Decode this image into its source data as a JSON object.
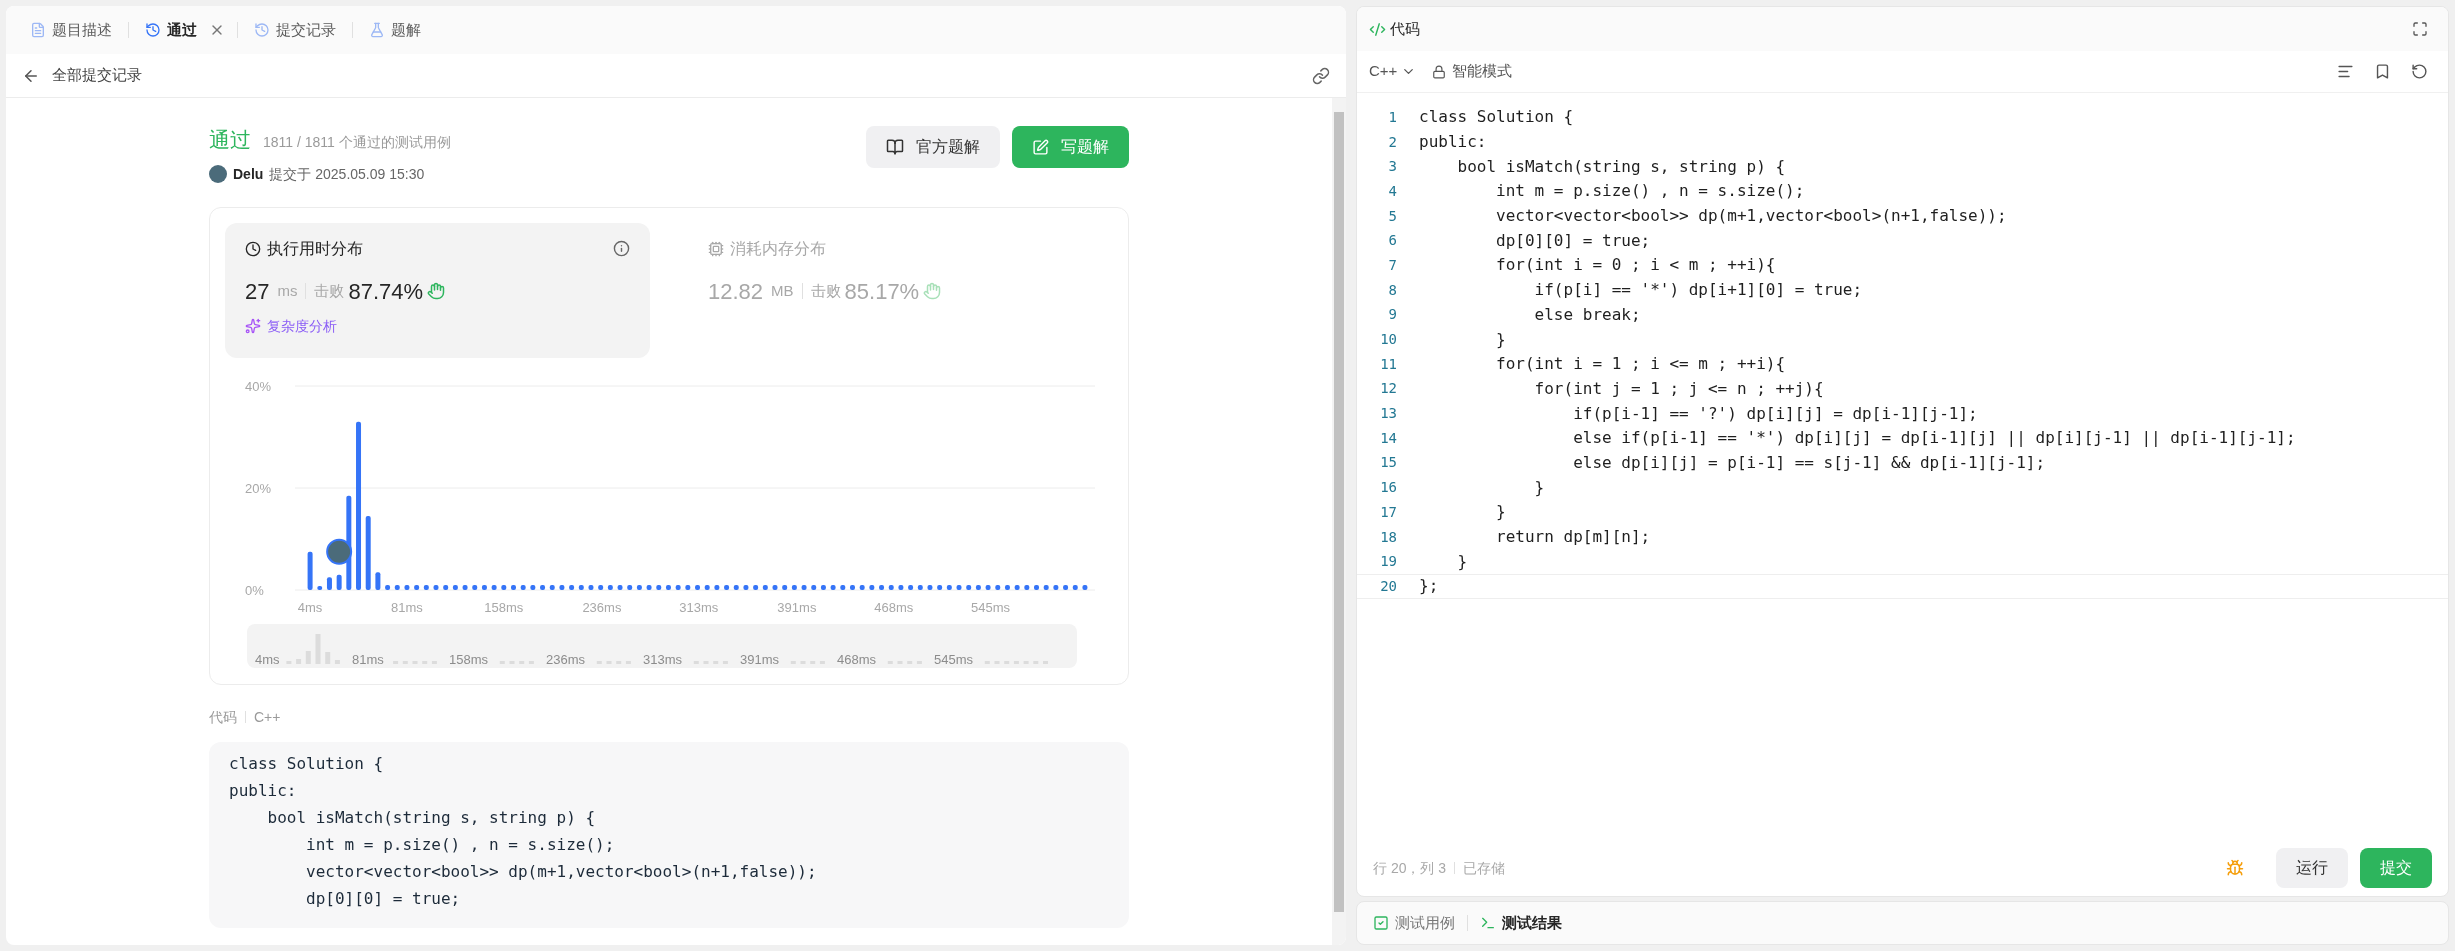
{
  "left_tabs": [
    {
      "label": "题目描述",
      "selected": false,
      "closable": false
    },
    {
      "label": "通过",
      "selected": true,
      "closable": true
    },
    {
      "label": "提交记录",
      "selected": false,
      "closable": false
    },
    {
      "label": "题解",
      "selected": false,
      "closable": false
    }
  ],
  "back_link": {
    "label": "全部提交记录"
  },
  "result": {
    "status": "通过",
    "detail": "1811 / 1811 个通过的测试用例",
    "user": "Delu",
    "submitted": "提交于 2025.05.09 15:30"
  },
  "actions": [
    {
      "label": "官方题解",
      "primary": false
    },
    {
      "label": "写题解",
      "primary": true
    }
  ],
  "stats": [
    {
      "title": "执行用时分布",
      "value": "27",
      "unit": "ms",
      "beats_label": "击败",
      "beats": "87.74%",
      "selected": true,
      "analysis": "复杂度分析"
    },
    {
      "title": "消耗内存分布",
      "value": "12.82",
      "unit": "MB",
      "beats_label": "击败",
      "beats": "85.17%",
      "selected": false
    }
  ],
  "chart_data": {
    "type": "bar",
    "ylim": [
      0,
      40
    ],
    "yticks": [
      {
        "value": 0,
        "label": "0%"
      },
      {
        "value": 20,
        "label": "20%"
      },
      {
        "value": 40,
        "label": "40%"
      }
    ],
    "xlim": [
      -8,
      628
    ],
    "xticks": [
      {
        "value": 4,
        "label": "4ms"
      },
      {
        "value": 81,
        "label": "81ms"
      },
      {
        "value": 158,
        "label": "158ms"
      },
      {
        "value": 236,
        "label": "236ms"
      },
      {
        "value": 313,
        "label": "313ms"
      },
      {
        "value": 391,
        "label": "391ms"
      },
      {
        "value": 468,
        "label": "468ms"
      },
      {
        "value": 545,
        "label": "545ms"
      }
    ],
    "x": [
      4,
      11.7,
      19.4,
      27.1,
      34.8,
      42.5,
      50.2,
      57.9,
      65.6,
      73.3,
      81,
      88.7,
      96.4,
      104.1,
      111.8,
      119.5,
      127.2,
      134.9,
      142.6,
      150.3,
      158,
      165.7,
      173.4,
      181.1,
      188.8,
      196.5,
      204.2,
      211.9,
      219.6,
      227.3,
      235,
      242.7,
      250.4,
      258.1,
      265.8,
      273.5,
      281.2,
      288.9,
      296.6,
      304.3,
      312,
      319.7,
      327.4,
      335.1,
      342.8,
      350.5,
      358.2,
      365.9,
      373.6,
      381.3,
      389,
      396.7,
      404.4,
      412.1,
      419.8,
      427.5,
      435.2,
      442.9,
      450.6,
      458.3,
      466,
      473.7,
      481.4,
      489.1,
      496.8,
      504.5,
      512.2,
      519.9,
      527.6,
      535.3,
      543,
      550.7,
      558.4,
      566.1,
      573.8,
      581.5,
      589.2,
      596.9,
      604.6,
      612.3,
      620
    ],
    "values": [
      7.5,
      0.8,
      2.5,
      3,
      18.5,
      33,
      14.5,
      3.5,
      1,
      1,
      1,
      1,
      1,
      1,
      1,
      1,
      1,
      1,
      1,
      1,
      1,
      1,
      1,
      1,
      1,
      1,
      1,
      1,
      1,
      1,
      1,
      1,
      1,
      1,
      1,
      1,
      1,
      1,
      1,
      1,
      1,
      1,
      1,
      1,
      1,
      1,
      1,
      1,
      1,
      1,
      1,
      1,
      1,
      1,
      1,
      1,
      1,
      1,
      1,
      1,
      1,
      1,
      1,
      1,
      1,
      1,
      1,
      1,
      1,
      1,
      1,
      1,
      1,
      1,
      1,
      1,
      1,
      1,
      1,
      1,
      1
    ]
  },
  "overview_labels": [
    "4ms",
    "81ms",
    "158ms",
    "236ms",
    "313ms",
    "391ms",
    "468ms",
    "545ms"
  ],
  "code_section": {
    "label": "代码",
    "language": "C++",
    "lines": [
      "class Solution {",
      "public:",
      "    bool isMatch(string s, string p) {",
      "        int m = p.size() , n = s.size();",
      "        vector<vector<bool>> dp(m+1,vector<bool>(n+1,false));",
      "        dp[0][0] = true;"
    ]
  },
  "editor": {
    "title": "代码",
    "language": "C++",
    "mode": "智能模式",
    "lines": [
      {
        "n": "1",
        "code": "class Solution {"
      },
      {
        "n": "2",
        "code": "public:"
      },
      {
        "n": "3",
        "code": "    bool isMatch(string s, string p) {"
      },
      {
        "n": "4",
        "code": "        int m = p.size() , n = s.size();"
      },
      {
        "n": "5",
        "code": "        vector<vector<bool>> dp(m+1,vector<bool>(n+1,false));"
      },
      {
        "n": "6",
        "code": "        dp[0][0] = true;"
      },
      {
        "n": "7",
        "code": "        for(int i = 0 ; i < m ; ++i){"
      },
      {
        "n": "8",
        "code": "            if(p[i] == '*') dp[i+1][0] = true;"
      },
      {
        "n": "9",
        "code": "            else break;"
      },
      {
        "n": "10",
        "code": "        }"
      },
      {
        "n": "11",
        "code": "        for(int i = 1 ; i <= m ; ++i){"
      },
      {
        "n": "12",
        "code": "            for(int j = 1 ; j <= n ; ++j){"
      },
      {
        "n": "13",
        "code": "                if(p[i-1] == '?') dp[i][j] = dp[i-1][j-1];"
      },
      {
        "n": "14",
        "code": "                else if(p[i-1] == '*') dp[i][j] = dp[i-1][j] || dp[i][j-1] || dp[i-1][j-1];"
      },
      {
        "n": "15",
        "code": "                else dp[i][j] = p[i-1] == s[j-1] && dp[i-1][j-1];"
      },
      {
        "n": "16",
        "code": "            }"
      },
      {
        "n": "17",
        "code": "        }"
      },
      {
        "n": "18",
        "code": "        return dp[m][n];"
      },
      {
        "n": "19",
        "code": "    }"
      },
      {
        "n": "20",
        "code": "};"
      }
    ],
    "cursor": "行 20，列 3",
    "saved": "已存储",
    "buttons": [
      {
        "label": "运行",
        "primary": false
      },
      {
        "label": "提交",
        "primary": true
      }
    ]
  },
  "bottom_tabs": [
    {
      "label": "测试用例",
      "selected": false
    },
    {
      "label": "测试结果",
      "selected": true
    }
  ]
}
